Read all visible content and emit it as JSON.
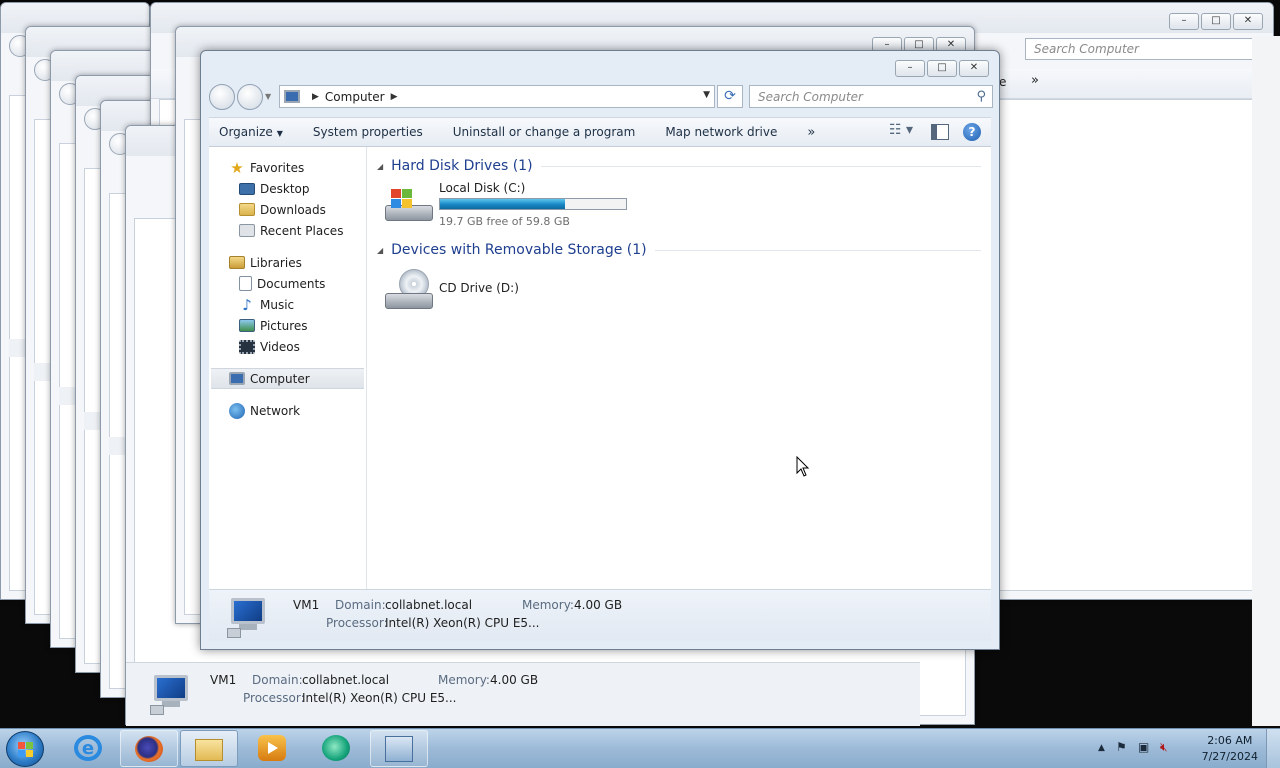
{
  "main_window": {
    "address": {
      "location": "Computer"
    },
    "search_placeholder": "Search Computer",
    "toolbar": {
      "organize": "Organize",
      "system_properties": "System properties",
      "uninstall": "Uninstall or change a program",
      "map_drive": "Map network drive",
      "more": "»"
    },
    "sidebar": {
      "favorites": "Favorites",
      "desktop": "Desktop",
      "downloads": "Downloads",
      "recent_places": "Recent Places",
      "libraries": "Libraries",
      "documents": "Documents",
      "music": "Music",
      "pictures": "Pictures",
      "videos": "Videos",
      "computer": "Computer",
      "network": "Network"
    },
    "groups": {
      "hdd_title": "Hard Disk Drives (1)",
      "removable_title": "Devices with Removable Storage (1)"
    },
    "drives": {
      "local_disk": {
        "name": "Local Disk (C:)",
        "free_text": "19.7 GB free of 59.8 GB",
        "used_fraction": 0.67
      },
      "cd_drive": {
        "name": "CD Drive (D:)"
      }
    },
    "details": {
      "name": "VM1",
      "domain_label": "Domain:",
      "domain": "collabnet.local",
      "memory_label": "Memory:",
      "memory": "4.00 GB",
      "processor_label": "Processor:",
      "processor": "Intel(R) Xeon(R) CPU E5..."
    }
  },
  "background_window": {
    "search_placeholder": "Search Computer",
    "toolbar_fragment": "e",
    "toolbar_more": "»",
    "details": {
      "name": "VM1",
      "domain_label": "Domain:",
      "domain": "collabnet.local",
      "memory_label": "Memory:",
      "memory": "4.00 GB",
      "processor_label": "Processor:",
      "processor": "Intel(R) Xeon(R) CPU E5..."
    }
  },
  "caption": {
    "minimize": "–",
    "maximize": "□",
    "close": "✕"
  },
  "taskbar": {
    "apps": [
      "internet-explorer",
      "firefox",
      "windows-explorer",
      "media-player",
      "teal-app",
      "control-panel"
    ],
    "tray_overflow": "▲",
    "clock": {
      "time": "2:06 AM",
      "date": "7/27/2024"
    }
  }
}
